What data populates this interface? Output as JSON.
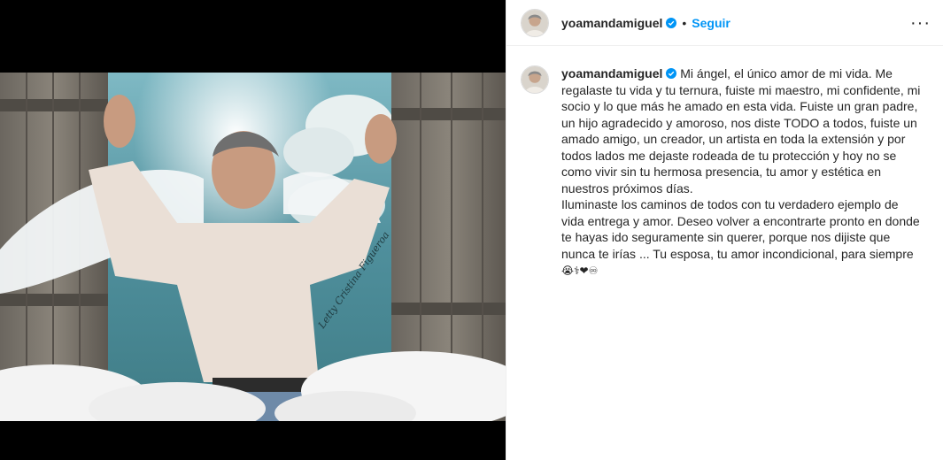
{
  "post": {
    "username": "yoamandamiguel",
    "follow_label": "Seguir",
    "separator": "•",
    "more_label": "···",
    "verified_icon": "verified-badge-icon",
    "accent_color": "#0095f6",
    "image_watermark": "Letty Cristina Figueroa",
    "caption_paragraph_1": "Mi ángel, el único amor de mi vida. Me regalaste tu vida y tu ternura, fuiste mi maestro, mi confidente, mi socio y lo que más he amado en esta vida. Fuiste un gran padre, un hijo agradecido y amoroso, nos diste TODO a todos, fuiste un amado amigo, un creador, un artista en toda la extensión y por todos lados me dejaste rodeada de tu protección y hoy no se como vivir sin tu hermosa presencia, tu amor y estética en nuestros próximos días.",
    "caption_paragraph_2": "Iluminaste los caminos de todos con tu verdadero ejemplo de vida entrega y amor. Deseo volver a encontrarte pronto en donde te hayas ido seguramente sin querer, porque nos dijiste que nunca te irías ... Tu esposa, tu amor incondicional, para siempre",
    "caption_emojis": "😭⚕❤♾"
  }
}
